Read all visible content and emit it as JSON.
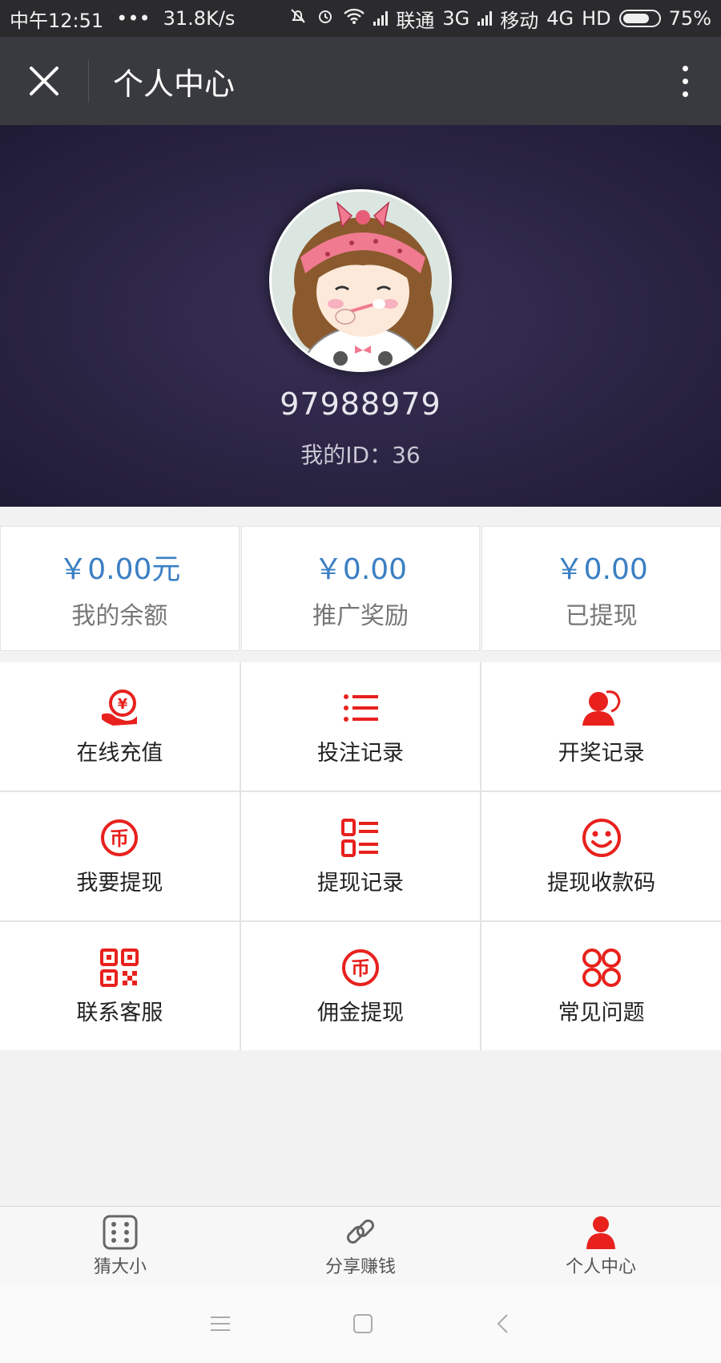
{
  "status": {
    "time": "中午12:51",
    "speed": "31.8K/s",
    "carrier1": "联通",
    "net1": "3G",
    "carrier2": "移动",
    "net2": "4G",
    "hd": "HD",
    "battery": "75%",
    "battery_level": 0.75
  },
  "header": {
    "title": "个人中心"
  },
  "profile": {
    "name": "97988979",
    "id_text": "我的ID：36"
  },
  "stats": [
    {
      "amount": "￥0.00元",
      "label": "我的余额"
    },
    {
      "amount": "￥0.00",
      "label": "推广奖励"
    },
    {
      "amount": "￥0.00",
      "label": "已提现"
    }
  ],
  "menu": [
    {
      "label": "在线充值",
      "icon": "recharge-icon"
    },
    {
      "label": "投注记录",
      "icon": "list-icon"
    },
    {
      "label": "开奖记录",
      "icon": "user-prize-icon"
    },
    {
      "label": "我要提现",
      "icon": "coin-icon"
    },
    {
      "label": "提现记录",
      "icon": "record-list-icon"
    },
    {
      "label": "提现收款码",
      "icon": "smile-icon"
    },
    {
      "label": "联系客服",
      "icon": "qrcode-icon"
    },
    {
      "label": "佣金提现",
      "icon": "coin-icon"
    },
    {
      "label": "常见问题",
      "icon": "four-circles-icon"
    }
  ],
  "tabs": [
    {
      "label": "猜大小",
      "icon": "dice-icon"
    },
    {
      "label": "分享赚钱",
      "icon": "link-icon"
    },
    {
      "label": "个人中心",
      "icon": "person-icon",
      "active": true
    }
  ],
  "colors": {
    "accent_red": "#e8211d",
    "amount_blue": "#3b7fc4",
    "header_bg": "#393a3f"
  }
}
